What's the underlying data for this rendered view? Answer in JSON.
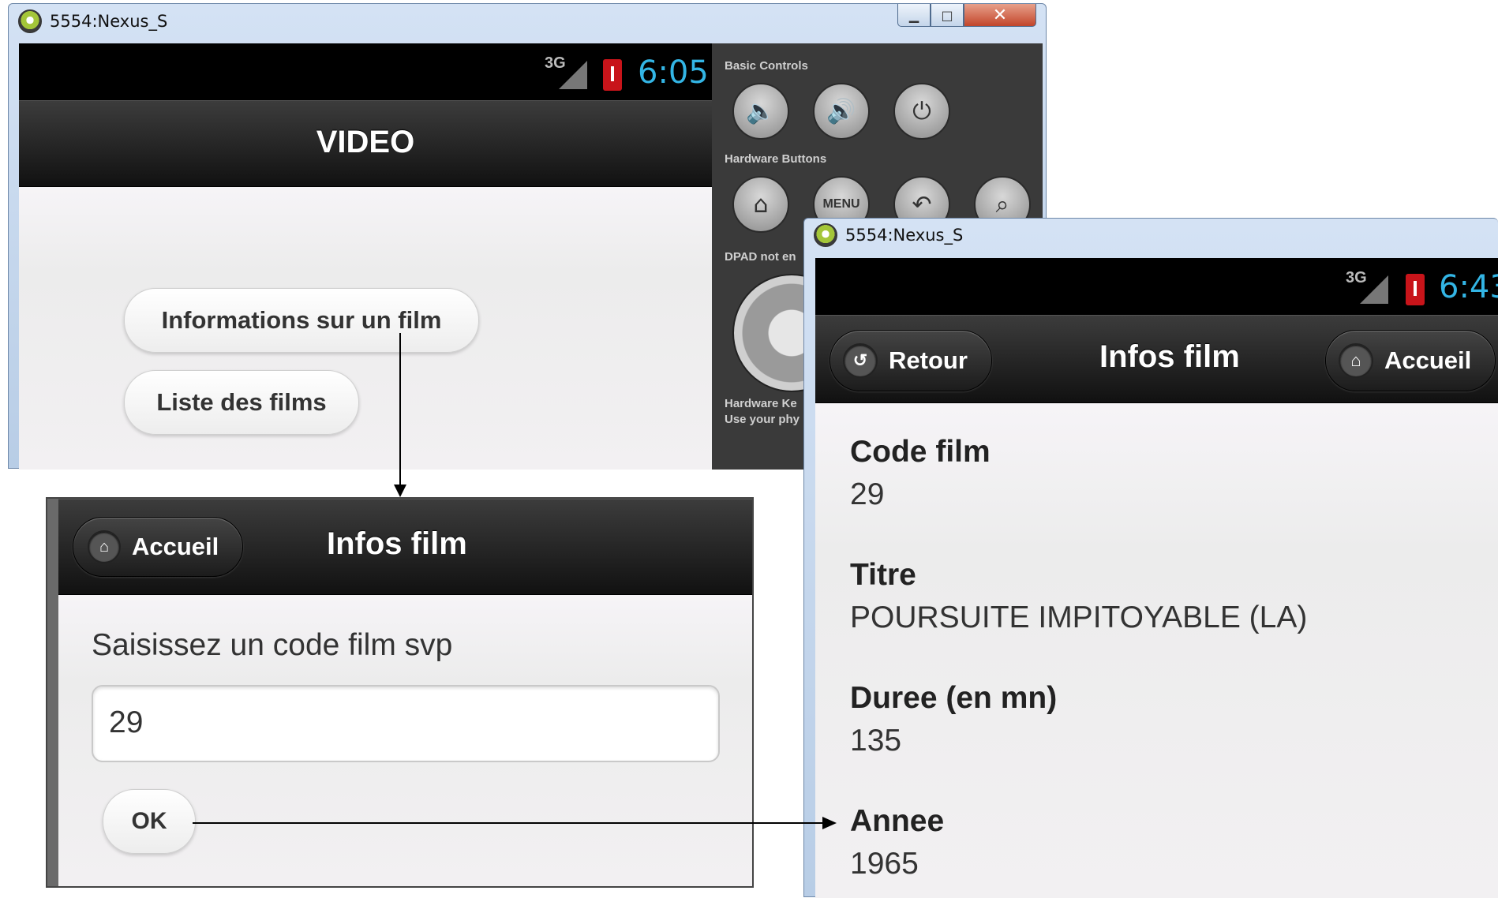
{
  "window1": {
    "title": "5554:Nexus_S",
    "status_network": "3G",
    "status_time": "6:05",
    "header_title": "VIDEO",
    "buttons": [
      "Informations sur un film",
      "Liste des films"
    ],
    "control_panel": {
      "basic_controls_label": "Basic Controls",
      "hardware_buttons_label": "Hardware Buttons",
      "menu_label": "MENU",
      "dpad_label": "DPAD not en",
      "hardware_keys_line1": "Hardware Ke",
      "hardware_keys_line2": "Use your phy"
    }
  },
  "window2": {
    "back_button": "Accueil",
    "header_title": "Infos film",
    "prompt": "Saisissez un code film svp",
    "input_value": "29",
    "ok_button": "OK"
  },
  "window3": {
    "title": "5554:Nexus_S",
    "status_network": "3G",
    "status_time": "6:43",
    "back_button": "Retour",
    "header_title": "Infos film",
    "home_button": "Accueil",
    "fields": [
      {
        "label": "Code film",
        "value": "29"
      },
      {
        "label": "Titre",
        "value": "POURSUITE IMPITOYABLE (LA)"
      },
      {
        "label": "Duree (en mn)",
        "value": "135"
      },
      {
        "label": "Annee",
        "value": "1965"
      }
    ]
  },
  "colors": {
    "status_time": "#33b5e5",
    "header_dark": "#1a1a1a",
    "content_bg": "#f2f0f2"
  },
  "icons": [
    "android-icon",
    "signal-icon",
    "battery-icon",
    "volume-down-icon",
    "volume-up-icon",
    "power-icon",
    "home-icon",
    "back-icon",
    "search-icon",
    "dpad-icon",
    "retour-icon"
  ]
}
